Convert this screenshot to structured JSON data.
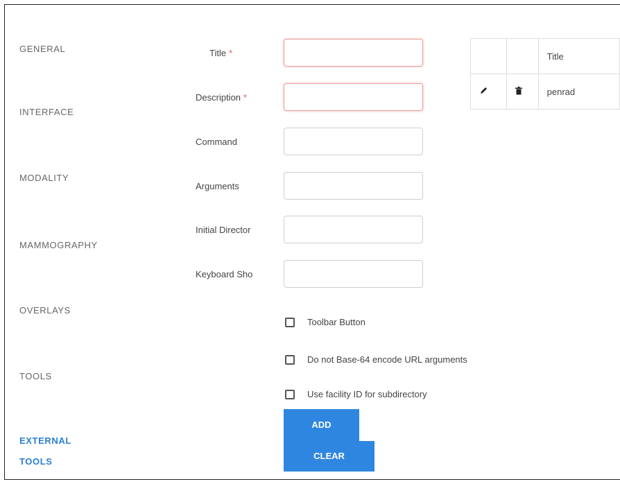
{
  "sidebar": {
    "items": [
      {
        "label": "GENERAL"
      },
      {
        "label": "INTERFACE"
      },
      {
        "label": "MODALITY"
      },
      {
        "label": "MAMMOGRAPHY"
      },
      {
        "label": "OVERLAYS"
      },
      {
        "label": "TOOLS"
      },
      {
        "label": "EXTERNAL TOOLS",
        "active": true
      }
    ]
  },
  "form": {
    "required_marker": "*",
    "fields": [
      {
        "label": "Title",
        "required": true,
        "value": ""
      },
      {
        "label": "Description",
        "required": true,
        "value": ""
      },
      {
        "label": "Command",
        "required": false,
        "value": ""
      },
      {
        "label": "Arguments",
        "required": false,
        "value": ""
      },
      {
        "label": "Initial Director",
        "required": false,
        "value": ""
      },
      {
        "label": "Keyboard Sho",
        "required": false,
        "value": ""
      }
    ],
    "checkboxes": [
      {
        "label": "Toolbar Button",
        "checked": false
      },
      {
        "label": "Do not Base-64 encode URL arguments",
        "checked": false
      },
      {
        "label": "Use facility ID for subdirectory",
        "checked": false
      }
    ],
    "add_label": "ADD",
    "clear_label": "CLEAR"
  },
  "table": {
    "headers": [
      "",
      "",
      "Title"
    ],
    "rows": [
      {
        "edit_icon": "pencil-icon",
        "delete_icon": "trash-icon",
        "title": "penrad"
      }
    ]
  },
  "colors": {
    "accent": "#2f86e0",
    "active_nav": "#2a7fd4",
    "required": "#e05a5a",
    "invalid_border": "#e8a0a0"
  }
}
